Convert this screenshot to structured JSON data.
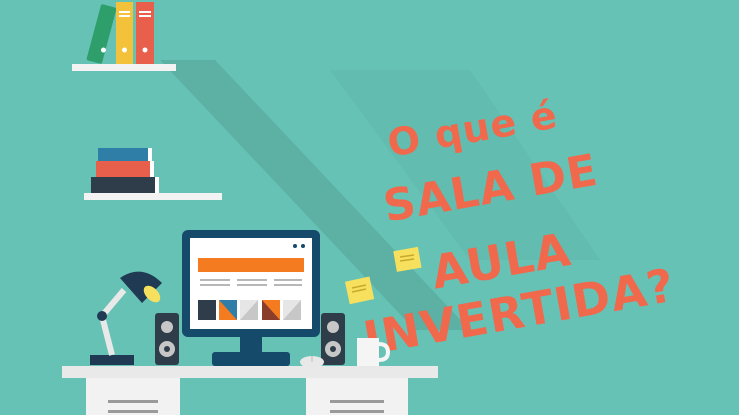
{
  "title": {
    "line1": "O que é",
    "line2": "SALA DE",
    "line3": "AULA",
    "line4": "INVERTIDA?"
  },
  "colors": {
    "background": "#67c2b6",
    "shadow": "#5aae9f",
    "title": "#f0694c",
    "monitor_frame": "#164a6a",
    "header_bar": "#f47b20",
    "desk": "#e8e8e8",
    "book_green": "#2e9e6b",
    "book_yellow": "#f4c23a",
    "book_red": "#e8604c",
    "sticky_note": "#f6e05e"
  },
  "icons": [
    "book-icon",
    "desk-lamp-icon",
    "speaker-icon",
    "monitor-icon",
    "coffee-mug-icon",
    "mouse-icon",
    "sticky-note-icon"
  ]
}
